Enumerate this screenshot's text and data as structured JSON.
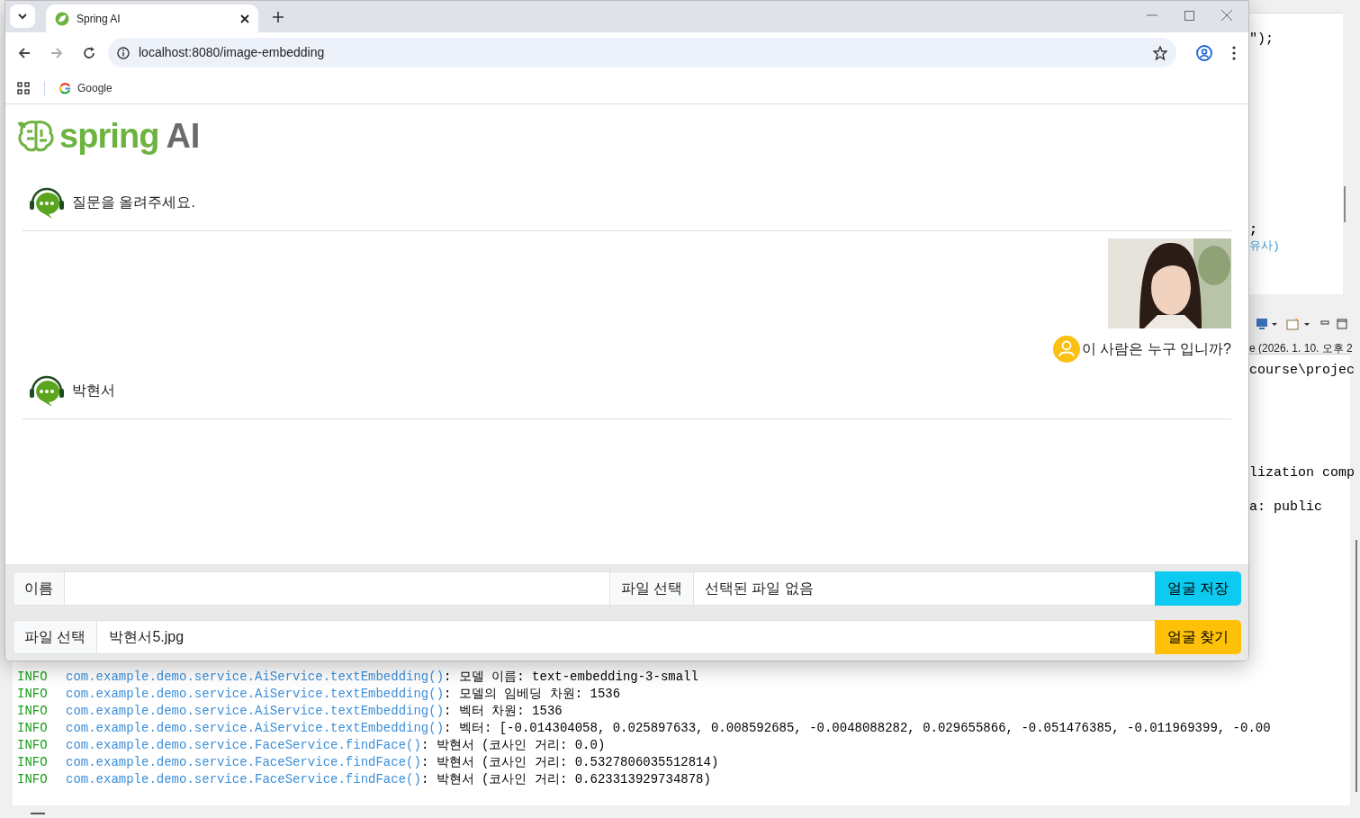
{
  "browser": {
    "tab_title": "Spring AI",
    "url": "localhost:8080/image-embedding",
    "bookmarks": [
      "Google"
    ]
  },
  "page": {
    "logo": {
      "word": "spring",
      "suffix": "AI"
    },
    "messages": [
      {
        "kind": "bot",
        "text": "질문을 올려주세요."
      },
      {
        "kind": "user",
        "text": "이 사람은 누구 입니까?"
      },
      {
        "kind": "bot",
        "text": "박현서"
      }
    ],
    "save_form": {
      "name_label": "이름",
      "file_button": "파일 선택",
      "file_status": "선택된 파일 없음",
      "submit": "얼굴 저장"
    },
    "find_form": {
      "file_button": "파일 선택",
      "file_name": "박현서5.jpg",
      "submit": "얼굴 찾기"
    }
  },
  "ide": {
    "editor_fragments": [
      "\");",
      ";",
      "유사)"
    ],
    "console_title": "e  (2026. 1. 10. 오후 2",
    "console_fragments": [
      "course\\projec",
      "lization comp",
      "a: public"
    ],
    "log": [
      {
        "level": "INFO",
        "source": "com.example.demo.service.AiService.textEmbedding()",
        "message": ": 모델 이름: text-embedding-3-small"
      },
      {
        "level": "INFO",
        "source": "com.example.demo.service.AiService.textEmbedding()",
        "message": ": 모델의 임베딩 차원: 1536"
      },
      {
        "level": "INFO",
        "source": "com.example.demo.service.AiService.textEmbedding()",
        "message": ": 벡터 차원: 1536"
      },
      {
        "level": "INFO",
        "source": "com.example.demo.service.AiService.textEmbedding()",
        "message": ": 벡터: [-0.014304058, 0.025897633, 0.008592685, -0.0048088282, 0.029655866, -0.051476385, -0.011969399, -0.00"
      },
      {
        "level": "INFO",
        "source": "com.example.demo.service.FaceService.findFace()",
        "message": ": 박현서 (코사인 거리: 0.0)"
      },
      {
        "level": "INFO",
        "source": "com.example.demo.service.FaceService.findFace()",
        "message": ": 박현서 (코사인 거리: 0.5327806035512814)"
      },
      {
        "level": "INFO",
        "source": "com.example.demo.service.FaceService.findFace()",
        "message": ": 박현서 (코사인 거리: 0.623313929734878)"
      }
    ]
  }
}
